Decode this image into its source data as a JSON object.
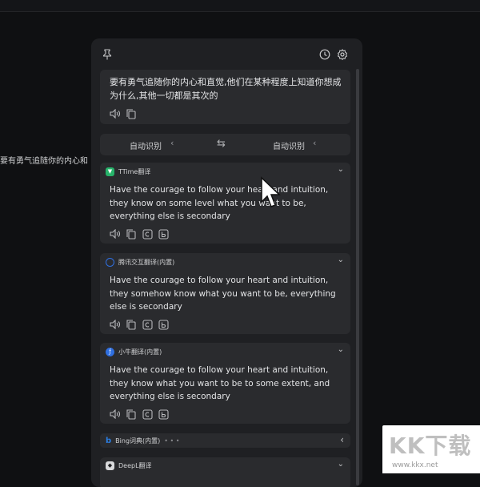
{
  "background_text": "要有勇气追随你的内心和",
  "source": {
    "text": "要有勇气追随你的内心和直觉,他们在某种程度上知道你想成为什么,其他一切都是其次的"
  },
  "lang_bar": {
    "source_lang": "自动识别",
    "target_lang": "自动识别"
  },
  "translations": [
    {
      "engine": "TTime翻译",
      "text": "Have the courage to follow your heart and intuition, they know on some level what you want to be, everything else is secondary"
    },
    {
      "engine": "腾讯交互翻译(内置)",
      "text": "Have the courage to follow your heart and intuition, they somehow know what you want to be, everything else is secondary"
    },
    {
      "engine": "小牛翻译(内置)",
      "text": "Have the courage to follow your heart and intuition, they know what you want to be to some extent, and everything else is secondary"
    }
  ],
  "bing": {
    "engine": "Bing词典(内置)",
    "loading": "• • •"
  },
  "deepl": {
    "engine": "DeepL翻译"
  },
  "watermark": {
    "title": "KK下载",
    "url": "www.kkx.net"
  },
  "colors": {
    "panel_bg": "#1f2023",
    "card_bg": "#2a2b2e",
    "ttime_logo": "#27b36a",
    "tencent_logo": "#2f6fe0",
    "niutrans_logo": "#2f6fe0",
    "bing_logo": "#2a7de1"
  }
}
